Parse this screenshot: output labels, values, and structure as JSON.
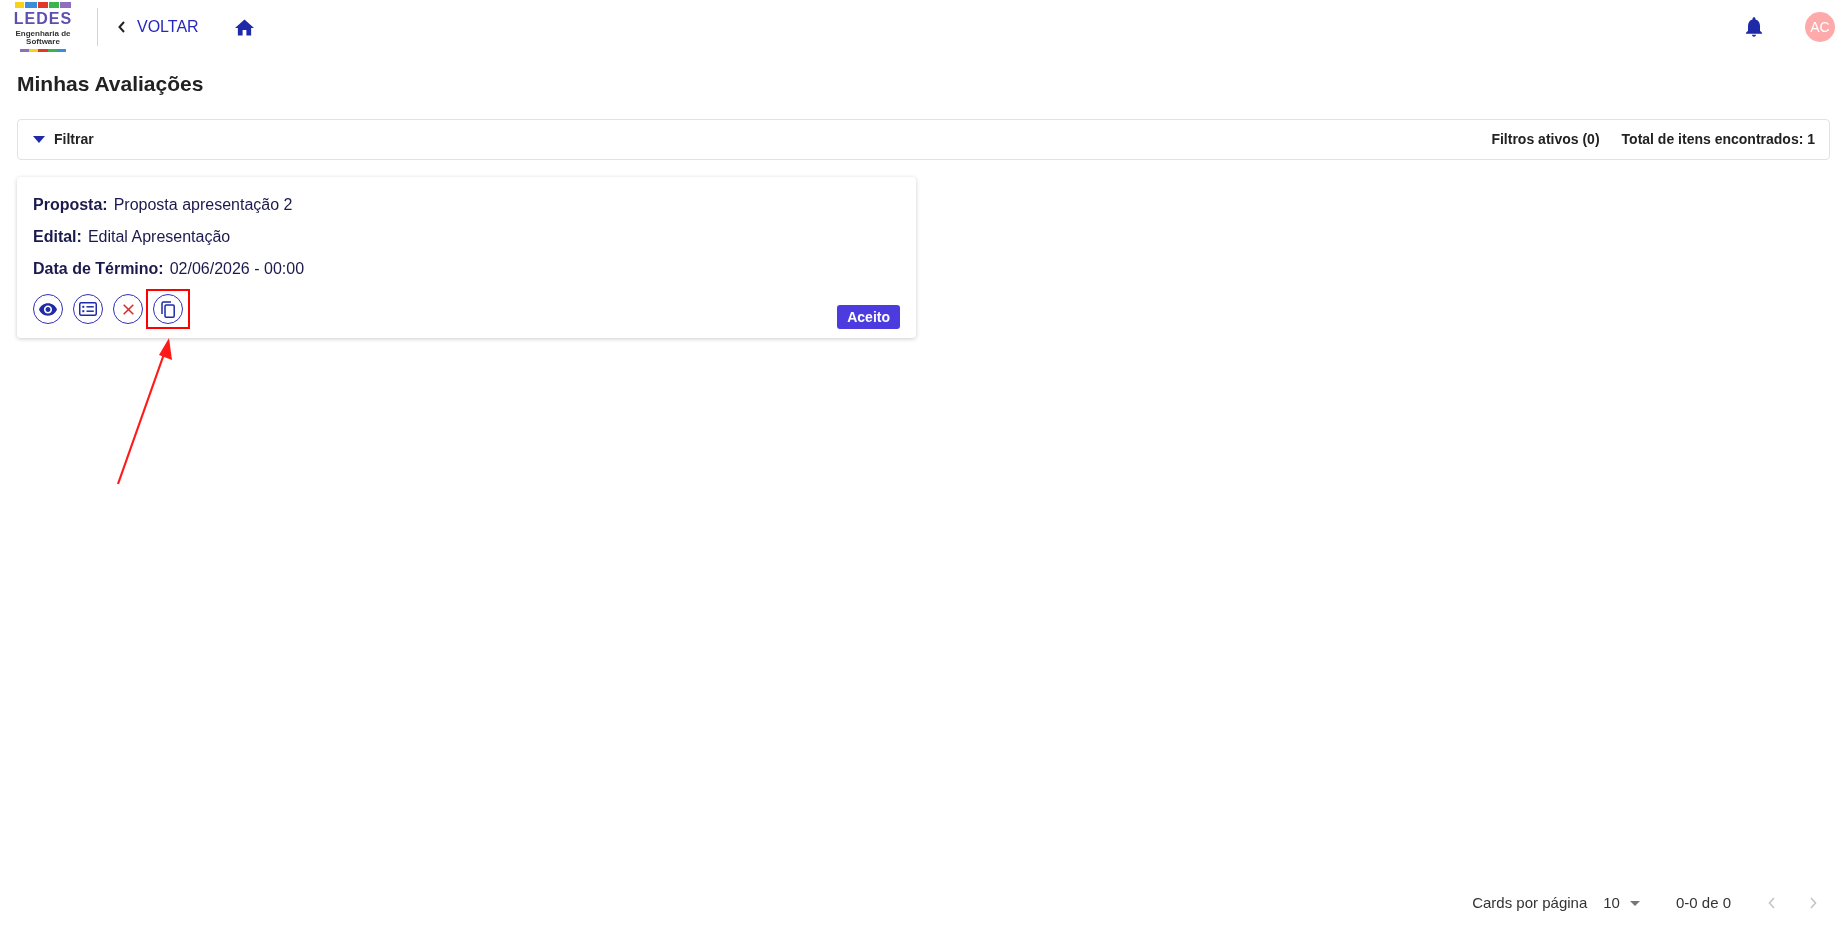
{
  "header": {
    "logo": {
      "title": "LEDES",
      "subtitle": "Engenharia de Software"
    },
    "back_link": "VOLTAR",
    "avatar_initials": "AC"
  },
  "page_title": "Minhas Avaliações",
  "filter_bar": {
    "label": "Filtrar",
    "active_filters": "Filtros ativos (0)",
    "total": "Total de itens encontrados: 1"
  },
  "cards": [
    {
      "fields": [
        {
          "label": "Proposta:",
          "value": "Proposta apresentação 2"
        },
        {
          "label": "Edital:",
          "value": "Edital Apresentação"
        },
        {
          "label": "Data de Término:",
          "value": "02/06/2026 - 00:00"
        }
      ],
      "actions": [
        {
          "kind": "view",
          "highlighted": false
        },
        {
          "kind": "list",
          "highlighted": false
        },
        {
          "kind": "reject",
          "highlighted": false
        },
        {
          "kind": "copy",
          "highlighted": true
        }
      ],
      "status": "Aceito"
    }
  ],
  "pagination": {
    "per_page_label": "Cards por página",
    "per_page": "10",
    "range": "0-0 de 0",
    "prev": {
      "disabled": true
    },
    "next": {
      "disabled": true
    }
  }
}
